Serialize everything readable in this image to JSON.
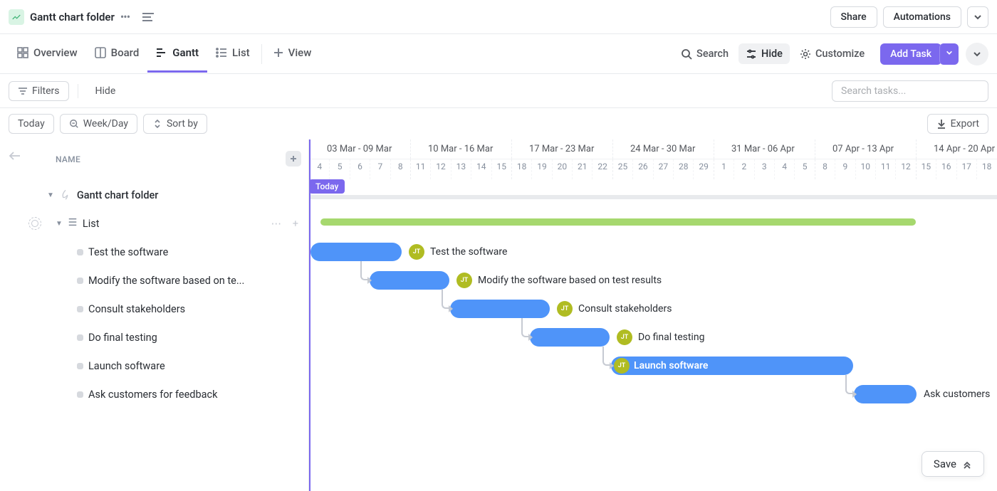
{
  "header": {
    "folder_title": "Gantt chart folder",
    "share": "Share",
    "automations": "Automations"
  },
  "tabs": {
    "overview": "Overview",
    "board": "Board",
    "gantt": "Gantt",
    "list": "List",
    "view": "View"
  },
  "tools": {
    "search": "Search",
    "hide": "Hide",
    "customize": "Customize",
    "add_task": "Add Task"
  },
  "filters": {
    "filters": "Filters",
    "hide": "Hide",
    "search_placeholder": "Search tasks..."
  },
  "controls": {
    "today": "Today",
    "week_day": "Week/Day",
    "sort_by": "Sort by",
    "export": "Export"
  },
  "sidebar": {
    "name_header": "NAME",
    "folder": "Gantt chart folder",
    "list": "List",
    "tasks": [
      "Test the software",
      "Modify the software based on te...",
      "Consult stakeholders",
      "Do final testing",
      "Launch software",
      "Ask customers for feedback"
    ]
  },
  "timeline": {
    "today_badge": "Today",
    "weeks": [
      "03 Mar - 09 Mar",
      "10 Mar - 16 Mar",
      "17 Mar - 23 Mar",
      "24 Mar - 30 Mar",
      "31 Mar - 06 Apr",
      "07 Apr - 13 Apr",
      "14 Apr - 20 Apr"
    ],
    "days": [
      "4",
      "5",
      "6",
      "7",
      "8",
      "11",
      "12",
      "13",
      "14",
      "15",
      "18",
      "19",
      "20",
      "21",
      "22",
      "25",
      "26",
      "27",
      "28",
      "29",
      "1",
      "2",
      "3",
      "4",
      "5",
      "8",
      "9",
      "10",
      "11",
      "12",
      "15",
      "16",
      "17",
      "18"
    ],
    "avatar_initials": "JT",
    "bars": [
      {
        "label": "Test the software"
      },
      {
        "label": "Modify the software based on test results"
      },
      {
        "label": "Consult stakeholders"
      },
      {
        "label": "Do final testing"
      },
      {
        "label": "Launch software"
      },
      {
        "label": "Ask customers"
      }
    ]
  },
  "save": "Save",
  "chart_data": {
    "type": "gantt",
    "title": "Gantt chart folder",
    "x_axis": {
      "unit": "date",
      "weeks": [
        "03 Mar - 09 Mar",
        "10 Mar - 16 Mar",
        "17 Mar - 23 Mar",
        "24 Mar - 30 Mar",
        "31 Mar - 06 Apr",
        "07 Apr - 13 Apr",
        "14 Apr - 20 Apr"
      ],
      "today": "04 Mar"
    },
    "group_bar": {
      "name": "List",
      "start": "04 Mar",
      "end": "12 Apr",
      "color": "#a6d86e"
    },
    "tasks": [
      {
        "name": "Test the software",
        "start": "04 Mar",
        "end": "08 Mar",
        "assignee": "JT",
        "depends_on": null
      },
      {
        "name": "Modify the software based on test results",
        "start": "08 Mar",
        "end": "12 Mar",
        "assignee": "JT",
        "depends_on": "Test the software"
      },
      {
        "name": "Consult stakeholders",
        "start": "12 Mar",
        "end": "18 Mar",
        "assignee": "JT",
        "depends_on": "Modify the software based on test results"
      },
      {
        "name": "Do final testing",
        "start": "18 Mar",
        "end": "22 Mar",
        "assignee": "JT",
        "depends_on": "Consult stakeholders"
      },
      {
        "name": "Launch software",
        "start": "22 Mar",
        "end": "08 Apr",
        "assignee": "JT",
        "depends_on": "Do final testing"
      },
      {
        "name": "Ask customers for feedback",
        "start": "08 Apr",
        "end": "12 Apr",
        "assignee": "JT",
        "depends_on": "Launch software"
      }
    ],
    "bar_color": "#4f94f9"
  }
}
